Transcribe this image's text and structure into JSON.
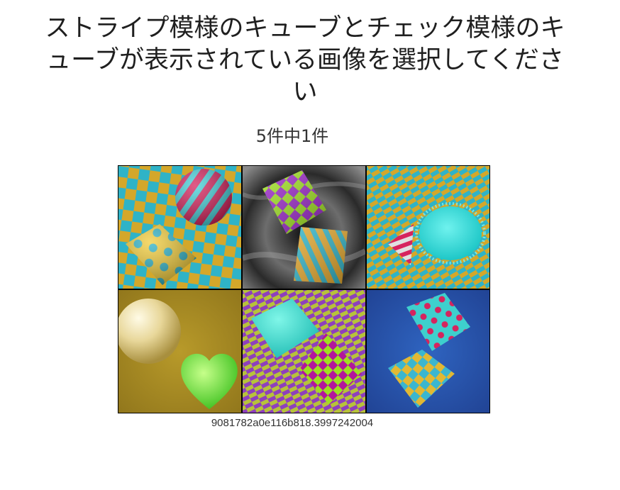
{
  "prompt": {
    "text": "ストライプ模様のキューブとチェック模様のキューブが表示されている画像を選択してください"
  },
  "progress": {
    "label": "5件中1件",
    "current": 1,
    "total": 5
  },
  "tiles": [
    {
      "id": 1,
      "contents": "checkered-background-striped-sphere-polka-dot-cube"
    },
    {
      "id": 2,
      "contents": "gray-swirl-background-checkered-cube-striped-cube"
    },
    {
      "id": 3,
      "contents": "woven-background-striped-cone-fluffy-blob"
    },
    {
      "id": 4,
      "contents": "olive-background-pearl-sphere-green-heart"
    },
    {
      "id": 5,
      "contents": "woven-background-turquoise-cube-checkered-cube"
    },
    {
      "id": 6,
      "contents": "blue-background-polka-dot-cube-checkered-cube"
    }
  ],
  "challenge_id": "9081782a0e116b818.3997242004",
  "colors": {
    "teal": "#2fb3c7",
    "mustard": "#d4a72a",
    "magenta": "#d6245e",
    "lime": "#9fe021",
    "purple": "#9b28c9",
    "olive": "#a58a22",
    "royal_blue": "#2753a8"
  }
}
